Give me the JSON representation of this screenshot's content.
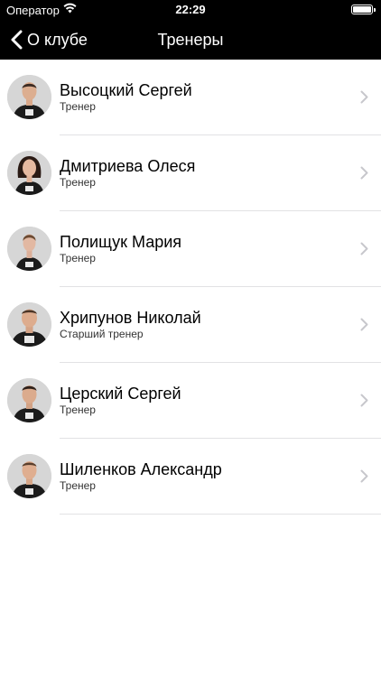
{
  "status_bar": {
    "carrier": "Оператор",
    "time": "22:29",
    "wifi_icon": "wifi-icon",
    "battery_icon": "battery-icon"
  },
  "nav": {
    "back_label": "О клубе",
    "title": "Тренеры"
  },
  "trainers": [
    {
      "name": "Высоцкий Сергей",
      "role": "Тренер"
    },
    {
      "name": "Дмитриева Олеся",
      "role": "Тренер"
    },
    {
      "name": "Полищук Мария",
      "role": "Тренер"
    },
    {
      "name": "Хрипунов Николай",
      "role": "Старший тренер"
    },
    {
      "name": "Церский Сергей",
      "role": "Тренер"
    },
    {
      "name": "Шиленков Александр",
      "role": "Тренер"
    }
  ],
  "colors": {
    "bar_background": "#000000",
    "list_background": "#ffffff",
    "separator": "#e2e2e4",
    "chevron": "#c7c7cc"
  }
}
